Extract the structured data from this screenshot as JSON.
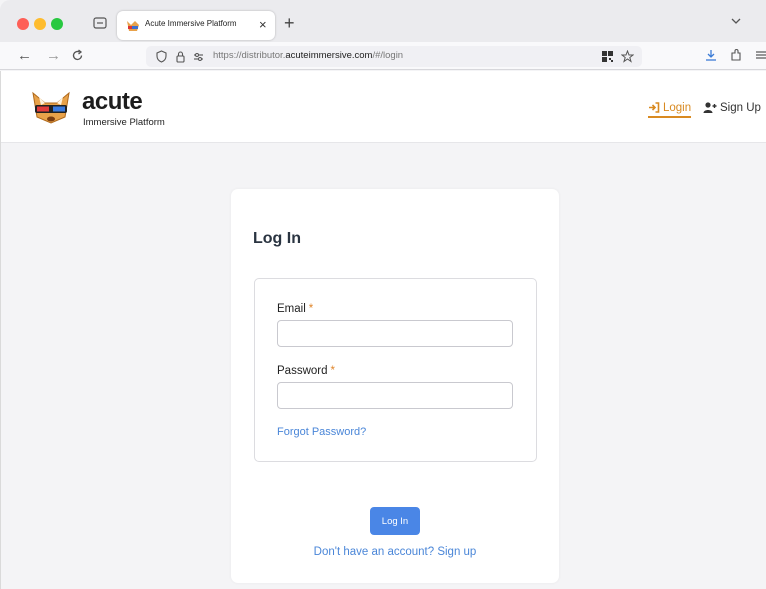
{
  "browser": {
    "tab_title": "Acute Immersive Platform",
    "tab_close": "×",
    "new_tab": "+",
    "url_prefix": "https://distributor.",
    "url_domain": "acuteimmersive.com",
    "url_path": "/#/login",
    "icons": [
      "tab-list-icon",
      "back-arrow-icon",
      "forward-arrow-icon",
      "reload-icon",
      "shield-icon",
      "lock-icon",
      "permissions-icon",
      "qr-code-icon",
      "star-icon",
      "download-icon",
      "extensions-icon",
      "menu-icon",
      "chevron-down-icon"
    ]
  },
  "header": {
    "brand_name": "acute",
    "brand_subtitle": "Immersive Platform",
    "nav_login": "Login",
    "nav_signup": "Sign Up"
  },
  "login": {
    "title": "Log In",
    "email_label": "Email",
    "password_label": "Password",
    "required_mark": "*",
    "email_value": "",
    "password_value": "",
    "forgot_link": "Forgot Password?",
    "submit_label": "Log In",
    "signup_link": "Don't have an account? Sign up"
  },
  "colors": {
    "accent_orange": "#d98a21",
    "link_blue": "#4a86d8",
    "button_blue": "#4a86e6"
  }
}
